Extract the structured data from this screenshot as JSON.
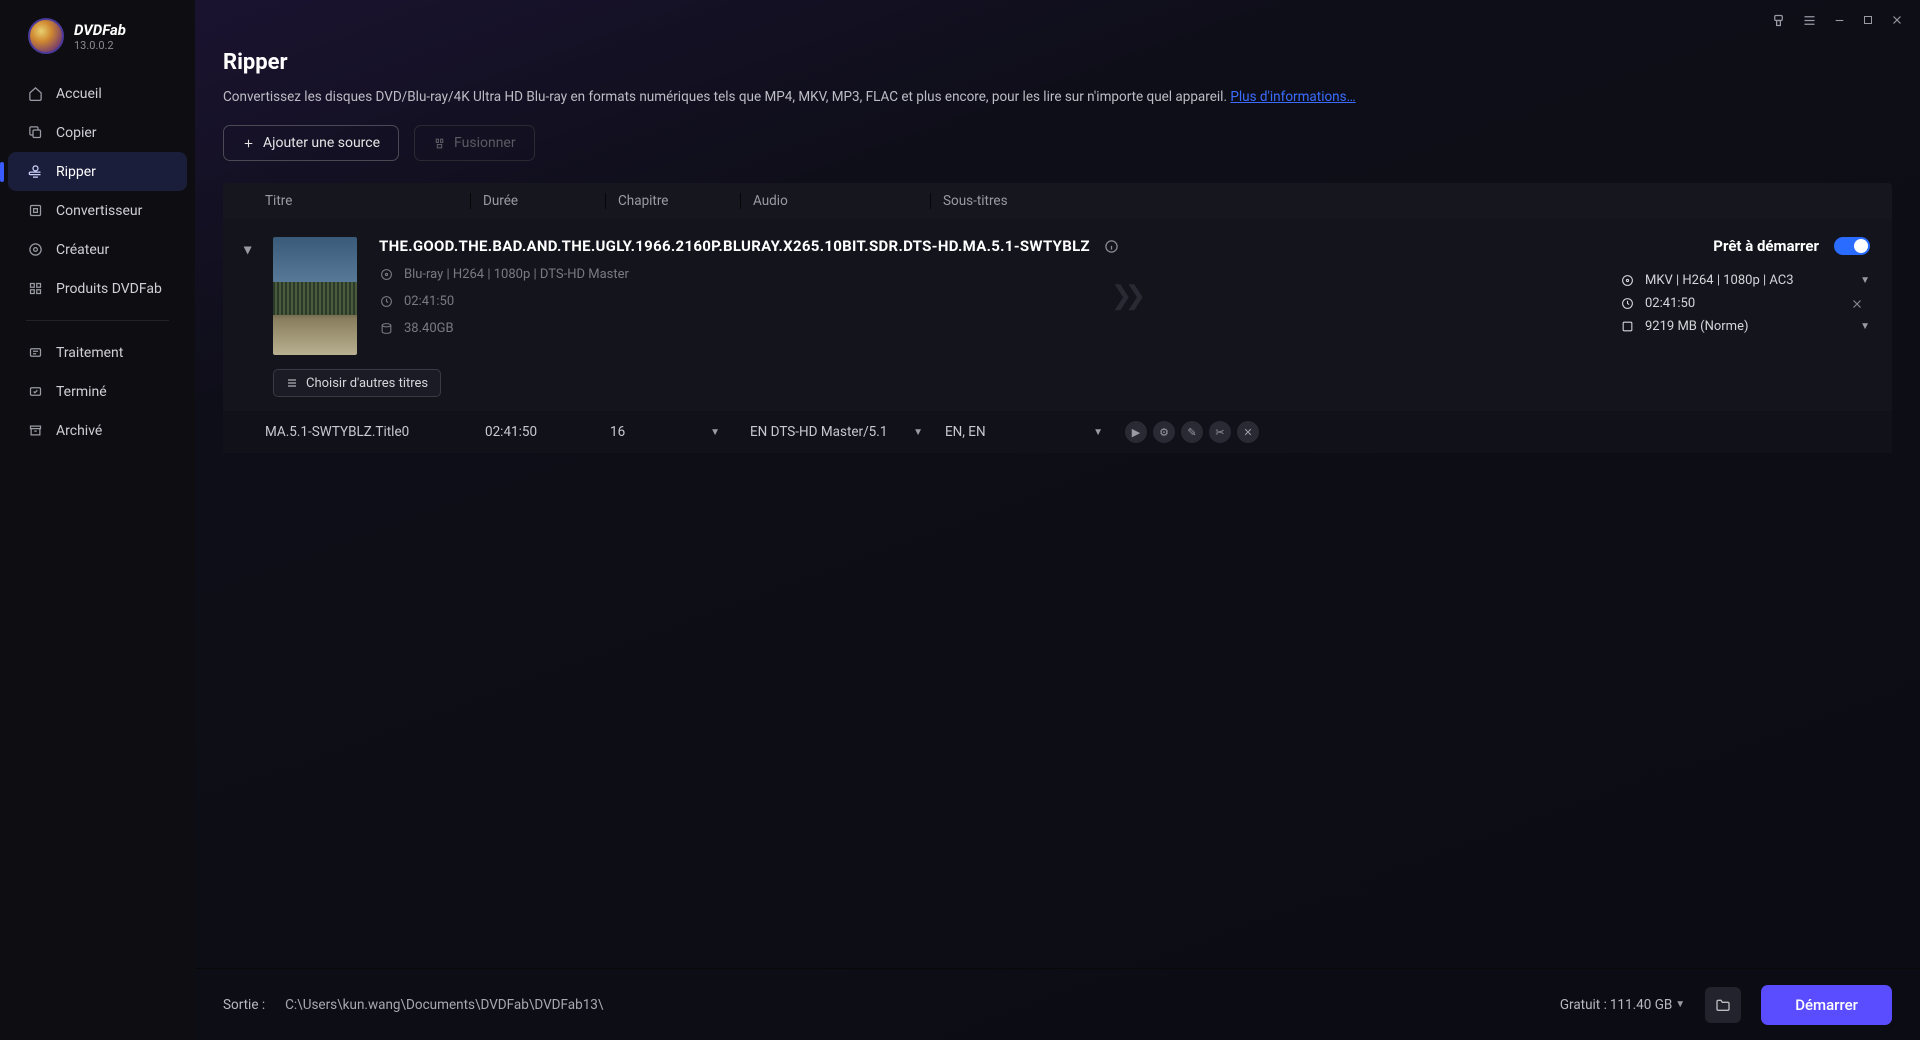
{
  "app": {
    "name": "DVDFab",
    "version": "13.0.0.2"
  },
  "sidebar": {
    "items": [
      {
        "label": "Accueil",
        "icon": "home-icon"
      },
      {
        "label": "Copier",
        "icon": "copy-icon"
      },
      {
        "label": "Ripper",
        "icon": "ripper-icon",
        "active": true
      },
      {
        "label": "Convertisseur",
        "icon": "converter-icon"
      },
      {
        "label": "Créateur",
        "icon": "creator-icon"
      },
      {
        "label": "Produits DVDFab",
        "icon": "products-icon"
      }
    ],
    "secondary": [
      {
        "label": "Traitement",
        "icon": "processing-icon"
      },
      {
        "label": "Terminé",
        "icon": "done-icon"
      },
      {
        "label": "Archivé",
        "icon": "archive-icon"
      }
    ]
  },
  "header": {
    "title": "Ripper",
    "description": "Convertissez les disques DVD/Blu-ray/4K Ultra HD Blu-ray en formats numériques tels que MP4, MKV, MP3, FLAC et plus encore, pour les lire sur n'importe quel appareil. ",
    "more_link": "Plus d'informations…",
    "add_source": "Ajouter une source",
    "merge": "Fusionner"
  },
  "columns": {
    "title": "Titre",
    "duration": "Durée",
    "chapter": "Chapitre",
    "audio": "Audio",
    "subtitles": "Sous-titres"
  },
  "task": {
    "title": "THE.GOOD.THE.BAD.AND.THE.UGLY.1966.2160P.BLURAY.X265.10BIT.SDR.DTS-HD.MA.5.1-SWTYBLZ",
    "ready_label": "Prêt à démarrer",
    "source_format": "Blu-ray | H264 | 1080p | DTS-HD Master",
    "source_duration": "02:41:50",
    "source_size": "38.40GB",
    "output_format": "MKV | H264 | 1080p | AC3",
    "output_duration": "02:41:50",
    "output_size": "9219 MB (Norme)",
    "choose_titles": "Choisir d'autres titres",
    "sub": {
      "title": "MA.5.1-SWTYBLZ.Title0",
      "duration": "02:41:50",
      "chapter": "16",
      "audio": "EN  DTS-HD Master/5.1",
      "subtitles": "EN, EN"
    }
  },
  "footer": {
    "output_label": "Sortie :",
    "output_path": "C:\\Users\\kun.wang\\Documents\\DVDFab\\DVDFab13\\",
    "free_label": "Gratuit : ",
    "free_value": "111.40 GB",
    "start": "Démarrer"
  }
}
